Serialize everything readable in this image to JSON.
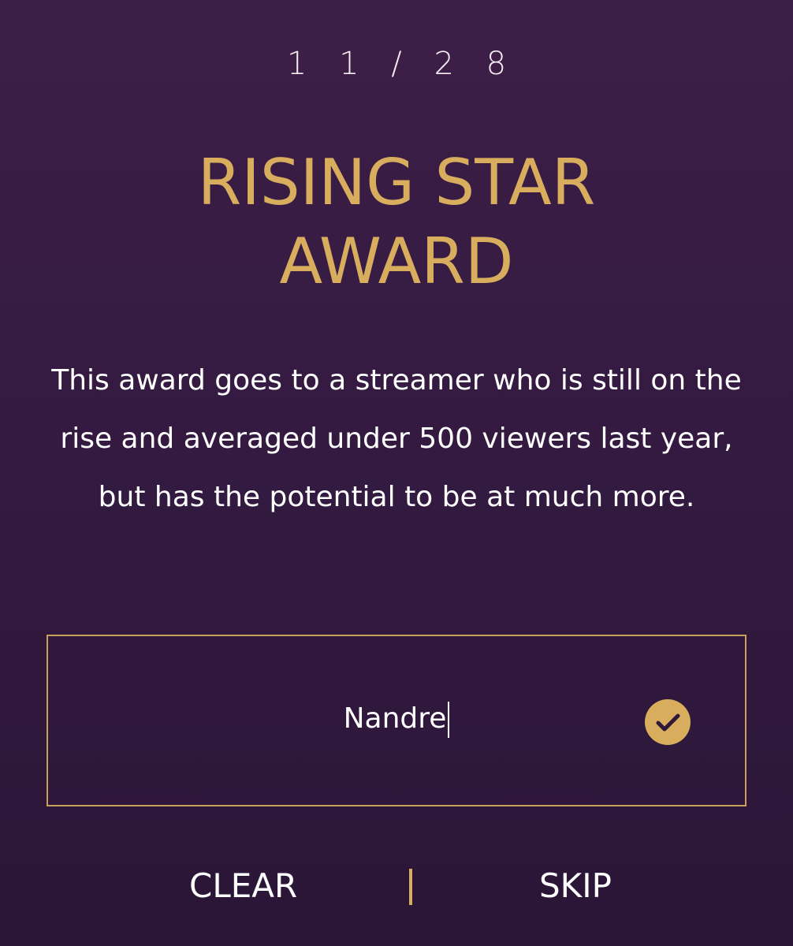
{
  "progress": {
    "counter": "1 1 / 2 8"
  },
  "award": {
    "title_line1": "RISING STAR",
    "title_line2": "AWARD",
    "description": "This award goes to a streamer who is still on the rise and averaged under 500 viewers last year, but has the potential to be at much more."
  },
  "nomination": {
    "value": "Nandre",
    "confirm_icon": "check-circle-icon"
  },
  "footer": {
    "clear_label": "CLEAR",
    "skip_label": "SKIP"
  },
  "colors": {
    "background": "#361b42",
    "accent_gold": "#d8ae5e",
    "text": "#ffffff"
  }
}
